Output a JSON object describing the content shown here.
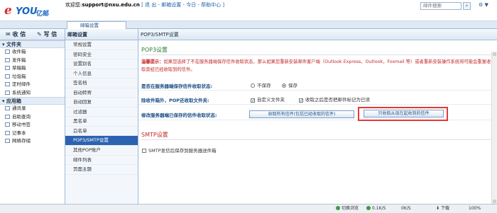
{
  "logo": {
    "e": "e",
    "you": "YOU",
    "cn": "亿邮"
  },
  "header": {
    "welcome_prefix": "欢迎您:",
    "email": "support@nxu.edu.cn",
    "links": "[ 退 出 - 邮箱设置 - 今日 - 帮助中心 ]",
    "search_placeholder": "邮件搜索",
    "topright": "⚙ ▼"
  },
  "tab": {
    "label": "邮箱设置"
  },
  "sidebar": {
    "receive_label": "收 信",
    "write_label": "写 信",
    "folders_title": "文件夹",
    "folders": [
      "收件箱",
      "发件箱",
      "草稿箱",
      "垃圾箱",
      "定时邮件",
      "系统通知"
    ],
    "apps_title": "应用箱",
    "apps": [
      "通讯录",
      "自助查询",
      "移动书签",
      "记事本",
      "网络存储"
    ]
  },
  "midcol": {
    "title": "邮箱设置",
    "items": [
      "常规设置",
      "密码安全",
      "设置别名",
      "个人信息",
      "签名档",
      "自动转寄",
      "自动回复",
      "过滤器",
      "黑名单",
      "白名单",
      "POP3/SMTP设置",
      "其他POP账户",
      "邮件列表",
      "页面主题"
    ],
    "selected": "POP3/SMTP设置"
  },
  "main": {
    "title": "POP3/SMTP设置",
    "pop3_title": "POP3设置",
    "warning_label": "温馨提示：",
    "warning_text": "如果您选择了不在服务器端保存信件收取状态，那么如果您重新安装邮件客户端（Outlook Express、Outlook，Foxmail 等）或者重新安装操作系统将可能会重复收取曾经已经收取到的信件。",
    "row1": {
      "label": "是否在服务器端保存信件收取状态:",
      "opt_no": "不保存",
      "opt_yes": "保存",
      "selected": "保存"
    },
    "row2": {
      "label": "除收件箱外，POP还收取文件夹:",
      "opt1": "自定义文件夹",
      "opt2": "收取之后是否把邮件标记为已读",
      "opt1_checked": true,
      "opt2_checked": true
    },
    "row3": {
      "label": "修改服务器端已保存的信件收取状态:",
      "btn1": "收取所有信件(包括已经收取的信件)",
      "btn2": "只收取从现在起收到的信件"
    },
    "smtp_title": "SMTP设置",
    "smtp_opt": "SMTP发信后保存到服务器送件箱"
  },
  "statusbar": {
    "switch": "切换浏览",
    "speed": "0.1K/S",
    "ok": "0K/S",
    "download": "下载",
    "zoom": "100%"
  },
  "colors": {
    "accent": "#2c63b0",
    "warning": "#c62828",
    "section_green": "#2e7d32",
    "highlight_box": "#e53935"
  }
}
